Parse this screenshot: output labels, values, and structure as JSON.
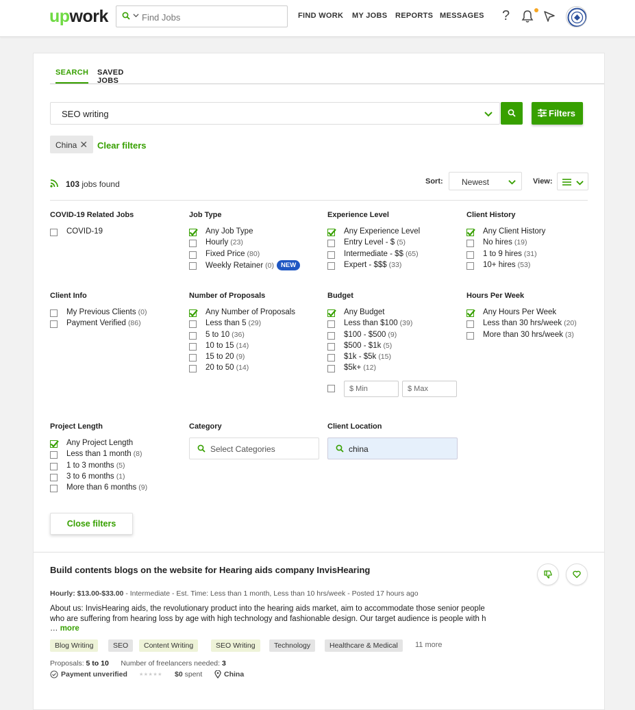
{
  "header": {
    "logo_up": "up",
    "logo_work": "work",
    "search_placeholder": "Find Jobs",
    "nav": [
      "FIND WORK",
      "MY JOBS",
      "REPORTS",
      "MESSAGES"
    ],
    "help": "?"
  },
  "tabs": [
    "SEARCH",
    "SAVED JOBS"
  ],
  "query": "SEO writing",
  "filters_button": "Filters",
  "chip": "China",
  "clear_filters": "Clear filters",
  "results": {
    "count": "103",
    "label": "jobs found"
  },
  "sort": {
    "label": "Sort:",
    "value": "Newest"
  },
  "view": {
    "label": "View:"
  },
  "groups": {
    "covid": {
      "title": "COVID-19 Related Jobs",
      "options": [
        {
          "label": "COVID-19",
          "count": "",
          "checked": false
        }
      ]
    },
    "jobtype": {
      "title": "Job Type",
      "options": [
        {
          "label": "Any Job Type",
          "count": "",
          "checked": true
        },
        {
          "label": "Hourly",
          "count": "(23)",
          "checked": false
        },
        {
          "label": "Fixed Price",
          "count": "(80)",
          "checked": false
        },
        {
          "label": "Weekly Retainer",
          "count": "(0)",
          "checked": false
        }
      ],
      "new_badge": "NEW"
    },
    "experience": {
      "title": "Experience Level",
      "options": [
        {
          "label": "Any Experience Level",
          "count": "",
          "checked": true
        },
        {
          "label": "Entry Level - $",
          "count": "(5)",
          "checked": false
        },
        {
          "label": "Intermediate - $$",
          "count": "(65)",
          "checked": false
        },
        {
          "label": "Expert - $$$",
          "count": "(33)",
          "checked": false
        }
      ]
    },
    "clienthistory": {
      "title": "Client History",
      "options": [
        {
          "label": "Any Client History",
          "count": "",
          "checked": true
        },
        {
          "label": "No hires",
          "count": "(19)",
          "checked": false
        },
        {
          "label": "1 to 9 hires",
          "count": "(31)",
          "checked": false
        },
        {
          "label": "10+ hires",
          "count": "(53)",
          "checked": false
        }
      ]
    },
    "clientinfo": {
      "title": "Client Info",
      "options": [
        {
          "label": "My Previous Clients",
          "count": "(0)",
          "checked": false
        },
        {
          "label": "Payment Verified",
          "count": "(86)",
          "checked": false
        }
      ]
    },
    "proposals": {
      "title": "Number of Proposals",
      "options": [
        {
          "label": "Any Number of Proposals",
          "count": "",
          "checked": true
        },
        {
          "label": "Less than 5",
          "count": "(29)",
          "checked": false
        },
        {
          "label": "5 to 10",
          "count": "(36)",
          "checked": false
        },
        {
          "label": "10 to 15",
          "count": "(14)",
          "checked": false
        },
        {
          "label": "15 to 20",
          "count": "(9)",
          "checked": false
        },
        {
          "label": "20 to 50",
          "count": "(14)",
          "checked": false
        }
      ]
    },
    "budget": {
      "title": "Budget",
      "options": [
        {
          "label": "Any Budget",
          "count": "",
          "checked": true
        },
        {
          "label": "Less than $100",
          "count": "(39)",
          "checked": false
        },
        {
          "label": "$100 - $500",
          "count": "(9)",
          "checked": false
        },
        {
          "label": "$500 - $1k",
          "count": "(5)",
          "checked": false
        },
        {
          "label": "$1k - $5k",
          "count": "(15)",
          "checked": false
        },
        {
          "label": "$5k+",
          "count": "(12)",
          "checked": false
        }
      ],
      "min": "$ Min",
      "max": "$ Max"
    },
    "hours": {
      "title": "Hours Per Week",
      "options": [
        {
          "label": "Any Hours Per Week",
          "count": "",
          "checked": true
        },
        {
          "label": "Less than 30 hrs/week",
          "count": "(20)",
          "checked": false
        },
        {
          "label": "More than 30 hrs/week",
          "count": "(3)",
          "checked": false
        }
      ]
    },
    "length": {
      "title": "Project Length",
      "options": [
        {
          "label": "Any Project Length",
          "count": "",
          "checked": true
        },
        {
          "label": "Less than 1 month",
          "count": "(8)",
          "checked": false
        },
        {
          "label": "1 to 3 months",
          "count": "(5)",
          "checked": false
        },
        {
          "label": "3 to 6 months",
          "count": "(1)",
          "checked": false
        },
        {
          "label": "More than 6 months",
          "count": "(9)",
          "checked": false
        }
      ]
    },
    "category": {
      "title": "Category",
      "placeholder": "Select Categories"
    },
    "location": {
      "title": "Client Location",
      "value": "china"
    }
  },
  "close_filters": "Close filters",
  "job": {
    "title": "Build contents blogs on the website for Hearing aids company InvisHearing",
    "rate": "Hourly: $13.00-$33.00",
    "meta": " - Intermediate - Est. Time: Less than 1 month, Less than 10 hrs/week - Posted 17 hours ago",
    "desc": "About us: InvisHearing aids, the revolutionary product into the hearing aids market, aim to accommodate those senior people who are suffering from hearing loss by age with high technology and fashionable design. Our target audience is people with h … ",
    "more": "more",
    "tags": [
      "Blog Writing",
      "SEO",
      "Content Writing",
      "SEO Writing",
      "Technology",
      "Healthcare & Medical"
    ],
    "more_tags": "11 more",
    "proposals_label": "Proposals:",
    "proposals_value": "5 to 10",
    "freelancers_label": "Number of freelancers needed:",
    "freelancers_value": "3",
    "payment": "Payment unverified",
    "spent_value": "$0",
    "spent_label": "spent",
    "location": "China"
  },
  "colors": {
    "accent": "#37a000",
    "logo": "#6fda44",
    "badge": "#1f57c3"
  }
}
